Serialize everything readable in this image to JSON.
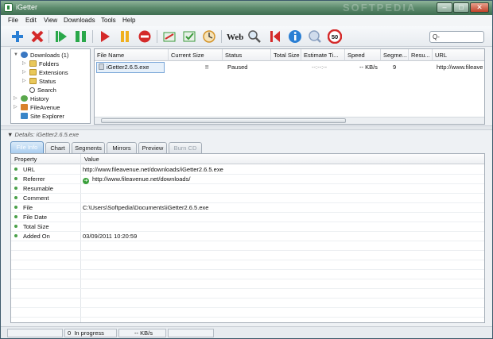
{
  "window": {
    "title": "iGetter",
    "watermark": "SOFTPEDIA",
    "minimize_glyph": "–",
    "maximize_glyph": "□",
    "close_glyph": "✕"
  },
  "menu": [
    "File",
    "Edit",
    "View",
    "Downloads",
    "Tools",
    "Help"
  ],
  "toolbar": {
    "buttons": [
      {
        "icon": "add-icon",
        "color": "#2a7fd4"
      },
      {
        "icon": "delete-icon",
        "color": "#d42a2a"
      },
      {
        "icon": "start-icon",
        "color": "#2aa84a"
      },
      {
        "icon": "start-all-icon",
        "color": "#2aa84a"
      },
      {
        "icon": "play-icon",
        "color": "#d42a2a"
      },
      {
        "icon": "pause-icon",
        "color": "#f0b020"
      },
      {
        "icon": "stop-icon",
        "color": "#d42a2a"
      },
      {
        "icon": "scheduler-icon",
        "color": "#3a9a3a"
      },
      {
        "icon": "site-explorer-icon",
        "color": "#3a9a3a"
      },
      {
        "icon": "clock-icon",
        "color": "#d4942a"
      },
      {
        "icon": "web-icon",
        "color": "#222222"
      },
      {
        "icon": "magnifier-icon",
        "color": "#555555"
      },
      {
        "icon": "skip-icon",
        "color": "#d42a2a"
      },
      {
        "icon": "info-icon",
        "color": "#2a7fd4"
      },
      {
        "icon": "help-icon",
        "color": "#8aa0c0"
      },
      {
        "icon": "speed-limit-icon",
        "color": "#d42a2a"
      }
    ],
    "web_label": "Web",
    "limit_label": "50",
    "search": {
      "placeholder": "Q-"
    }
  },
  "tree": {
    "downloads": {
      "label": "Downloads",
      "count": "(1)"
    },
    "children": [
      "Folders",
      "Extensions",
      "Status",
      "Search"
    ],
    "roots": [
      "History",
      "FileAvenue",
      "Site Explorer"
    ]
  },
  "grid": {
    "columns": [
      "File Name",
      "Current Size",
      "Status",
      "Total Size",
      "Estimate Ti...",
      "Speed",
      "Segme...",
      "Resu...",
      "URL"
    ],
    "rows": [
      {
        "file_name": "iGetter2.6.5.exe",
        "current_size": "!!",
        "status": "Paused",
        "total_size": "",
        "estimate": "--:--:--",
        "speed": "-- KB/s",
        "segments": "9",
        "resume": "",
        "url": "http://www.fileave"
      }
    ]
  },
  "details": {
    "label": "Details:",
    "file": "iGetter2.6.5.exe",
    "tabs": [
      "File Info",
      "Chart",
      "Segments",
      "Mirrors",
      "Preview",
      "Burn CD"
    ],
    "active_tab": "File Info",
    "columns": [
      "Property",
      "Value"
    ],
    "rows": [
      {
        "property": "URL",
        "value": "http://www.fileavenue.net/downloads/iGetter2.6.5.exe"
      },
      {
        "property": "Referrer",
        "value": "http://www.fileavenue.net/downloads/"
      },
      {
        "property": "Resumable",
        "value": ""
      },
      {
        "property": "Comment",
        "value": ""
      },
      {
        "property": "File",
        "value": "C:\\Users\\Softpedia\\Documents\\iGetter2.6.5.exe"
      },
      {
        "property": "File Date",
        "value": ""
      },
      {
        "property": "Total Size",
        "value": ""
      },
      {
        "property": "Added On",
        "value": "03/09/2011 10:20:59"
      }
    ]
  },
  "statusbar": {
    "in_progress_count": "0",
    "in_progress_label": "In progress",
    "speed": "-- KB/s"
  }
}
